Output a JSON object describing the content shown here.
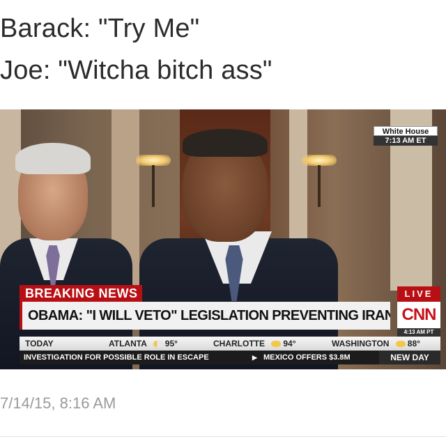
{
  "tweet": {
    "caption_line1": "Barack: \"Try Me\"",
    "caption_line2": "Joe: \"Witcha bitch ass\"",
    "timestamp": "7/14/15, 8:16 AM"
  },
  "broadcast": {
    "location_badge": "White House",
    "location_time": "7:13 AM ET",
    "breaking_label": "BREAKING NEWS",
    "live_label": "LIVE",
    "headline": "OBAMA: \"I WILL VETO\" LEGISLATION PREVENTING IRAN DEAL",
    "network_logo": "CNN",
    "network_time": "4:13 AM PT",
    "weather": {
      "today_label": "TODAY",
      "cities": [
        {
          "name": "ATLANTA",
          "temp": "95°",
          "icon": "partly-cloudy-icon"
        },
        {
          "name": "CHARLOTTE",
          "temp": "94°",
          "icon": "sun-icon"
        },
        {
          "name": "WASHINGTON",
          "temp": "88°",
          "icon": "sun-icon"
        }
      ]
    },
    "crawl": {
      "item1": "INVESTIGATION FOR POSSIBLE ROLE IN ESCAPE",
      "item2": "MEXICO OFFERS $3.8M",
      "show": "NEW DAY"
    }
  },
  "colors": {
    "cnn_red": "#b80f14",
    "caption_text": "#2b2b2b",
    "timestamp_text": "#9a9a9a"
  }
}
